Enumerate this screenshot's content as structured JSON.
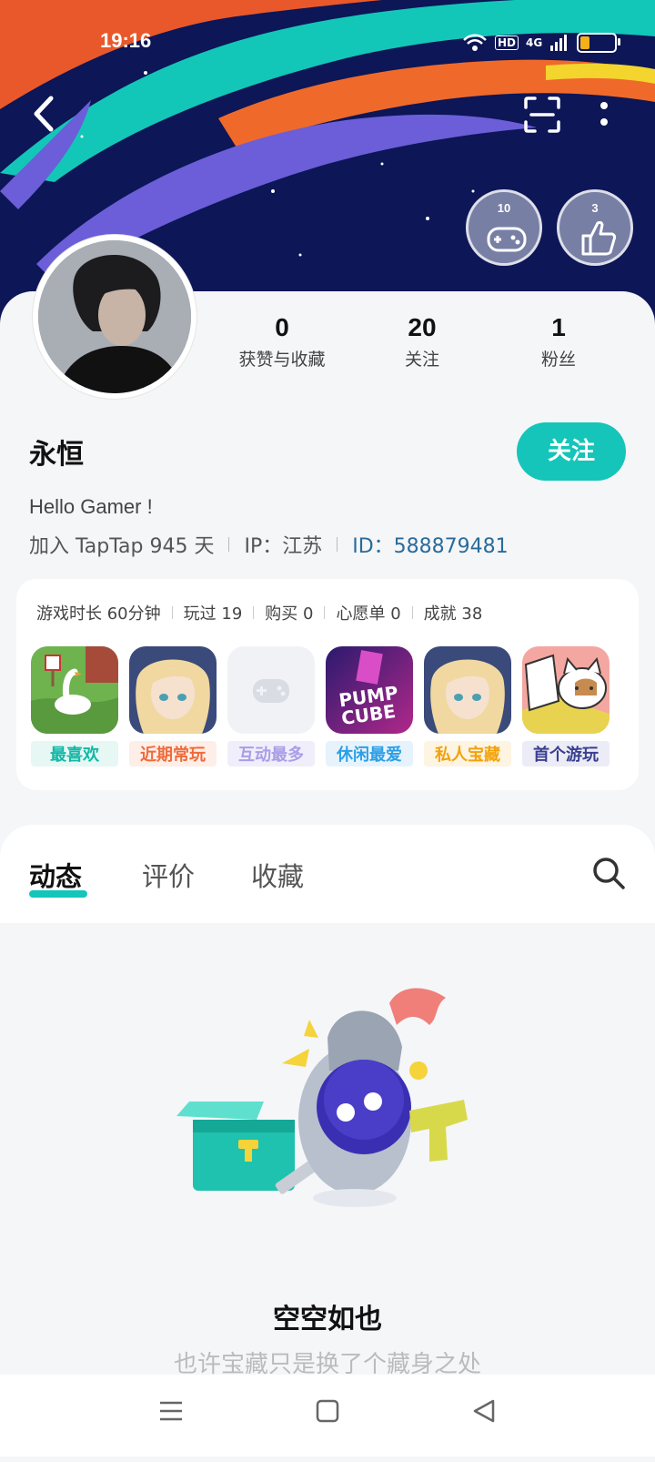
{
  "status": {
    "time": "19:16",
    "network": "4G",
    "hd": "HD"
  },
  "badges": [
    {
      "num": "10"
    },
    {
      "num": "3"
    }
  ],
  "stats": [
    {
      "value": "0",
      "label": "获赞与收藏"
    },
    {
      "value": "20",
      "label": "关注"
    },
    {
      "value": "1",
      "label": "粉丝"
    }
  ],
  "profile": {
    "name": "永恒",
    "follow_label": "关注",
    "bio": "Hello Gamer !",
    "joined": "加入 TapTap 945 天",
    "ip": "IP：江苏",
    "id": "ID：588879481"
  },
  "game_stats": [
    "游戏时长 60分钟",
    "玩过 19",
    "购买 0",
    "心愿单 0",
    "成就 38"
  ],
  "games": [
    {
      "tag": "最喜欢",
      "tag_color": "#13b8a6",
      "tag_bg": "#e6f7f4"
    },
    {
      "tag": "近期常玩",
      "tag_color": "#f06a3a",
      "tag_bg": "#fdeee7"
    },
    {
      "tag": "互动最多",
      "tag_color": "#a99ee6",
      "tag_bg": "#f1eefb"
    },
    {
      "tag": "休闲最爱",
      "tag_color": "#2c9fe6",
      "tag_bg": "#e7f3fc"
    },
    {
      "tag": "私人宝藏",
      "tag_color": "#f2a20e",
      "tag_bg": "#fdf4e1"
    },
    {
      "tag": "首个游玩",
      "tag_color": "#3a3f8f",
      "tag_bg": "#ebecf6"
    }
  ],
  "tabs": [
    {
      "label": "动态",
      "active": true
    },
    {
      "label": "评价",
      "active": false
    },
    {
      "label": "收藏",
      "active": false
    }
  ],
  "empty": {
    "title": "空空如也",
    "subtitle": "也许宝藏只是换了个藏身之处"
  },
  "colors": {
    "accent": "#15c5b9"
  }
}
